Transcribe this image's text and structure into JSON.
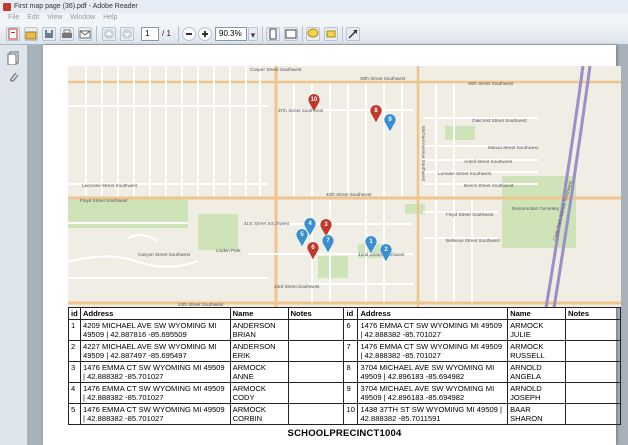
{
  "window": {
    "title": "First map page (36).pdf - Adobe Reader"
  },
  "menu": [
    "File",
    "Edit",
    "View",
    "Window",
    "Help"
  ],
  "toolbar": {
    "page_current": "1",
    "page_total": "/ 1",
    "zoom": "90.3%",
    "icons": [
      "create-pdf-icon",
      "open-icon",
      "save-icon",
      "print-icon",
      "email-icon",
      "prev-page-icon",
      "next-page-icon",
      "zoom-out-icon",
      "zoom-in-icon",
      "fit-page-icon",
      "fit-width-icon",
      "comment-icon",
      "highlight-icon",
      "expand-icon"
    ]
  },
  "map": {
    "street_labels": [
      "Cooper Street Southwest",
      "36th Street Southwest",
      "37th Street Southwest",
      "38th Street Southwest",
      "Oakcrest Street Southwest",
      "Marcia Street Southwest",
      "Ardell Street Southwest",
      "Lorraine Street Southwest",
      "Beech Street Southwest",
      "Lacrosse Street Southwest",
      "Floyd Street Southwest",
      "40th Street Southwest",
      "41st Street Southwest",
      "Floyd Street Southwest",
      "Bellevue Street Southwest",
      "42nd Street Southwest",
      "43rd Street Southwest",
      "44th Street Southwest",
      "Resurrection Cemetery",
      "Clyde Park Avenue Southwest",
      "Linden Park",
      "Canyon Street Southwest",
      "Michael Avenue Southwest"
    ],
    "markers": [
      {
        "label": "1",
        "color": "#3a8fd1"
      },
      {
        "label": "2",
        "color": "#3a8fd1"
      },
      {
        "label": "3",
        "color": "#c0392b"
      },
      {
        "label": "4",
        "color": "#3a8fd1"
      },
      {
        "label": "5",
        "color": "#3a8fd1"
      },
      {
        "label": "6",
        "color": "#c0392b"
      },
      {
        "label": "7",
        "color": "#3a8fd1"
      },
      {
        "label": "8",
        "color": "#c0392b"
      },
      {
        "label": "9",
        "color": "#3a8fd1"
      },
      {
        "label": "10",
        "color": "#c0392b"
      }
    ]
  },
  "table": {
    "headers": [
      "id",
      "Address",
      "Name",
      "Notes",
      "id",
      "Address",
      "Name",
      "Notes"
    ],
    "rows": [
      {
        "id_a": "1",
        "addr_a": "4209 MICHAEL AVE SW WYOMING MI 49509 | 42.887816 -85.695509",
        "name_a": "ANDERSON BRIAN",
        "notes_a": "",
        "id_b": "6",
        "addr_b": "1476 EMMA CT SW WYOMING MI 49509 | 42.888382 -85.701027",
        "name_b": "ARMOCK JULIE",
        "notes_b": ""
      },
      {
        "id_a": "2",
        "addr_a": "4227 MICHAEL AVE SW WYOMING MI 49509 | 42.887497 -85.695497",
        "name_a": "ANDERSON ERIK",
        "notes_a": "",
        "id_b": "7",
        "addr_b": "1476 EMMA CT SW WYOMING MI 49509 | 42.888382 -85.701027",
        "name_b": "ARMOCK RUSSELL",
        "notes_b": ""
      },
      {
        "id_a": "3",
        "addr_a": "1476 EMMA CT SW WYOMING MI 49509 | 42.888382 -85.701027",
        "name_a": "ARMOCK ANNE",
        "notes_a": "",
        "id_b": "8",
        "addr_b": "3704 MICHAEL AVE SW WYOMING MI 49509 | 42.896183 -85.694982",
        "name_b": "ARNOLD ANGELA",
        "notes_b": ""
      },
      {
        "id_a": "4",
        "addr_a": "1476 EMMA CT SW WYOMING MI 49509 | 42.888382 -85.701027",
        "name_a": "ARMOCK CODY",
        "notes_a": "",
        "id_b": "9",
        "addr_b": "3704 MICHAEL AVE SW WYOMING MI 49509 | 42.896183 -85.694982",
        "name_b": "ARNOLD JOSEPH",
        "notes_b": ""
      },
      {
        "id_a": "5",
        "addr_a": "1476 EMMA CT SW WYOMING MI 49509 | 42.888382 -85.701027",
        "name_a": "ARMOCK CORBIN",
        "notes_a": "",
        "id_b": "10",
        "addr_b": "1438 37TH ST SW WYOMING MI 49509 | 42.888382 -85.7011591",
        "name_b": "BAAR SHARON",
        "notes_b": ""
      }
    ]
  },
  "caption": "SCHOOLPRECINCT1004"
}
